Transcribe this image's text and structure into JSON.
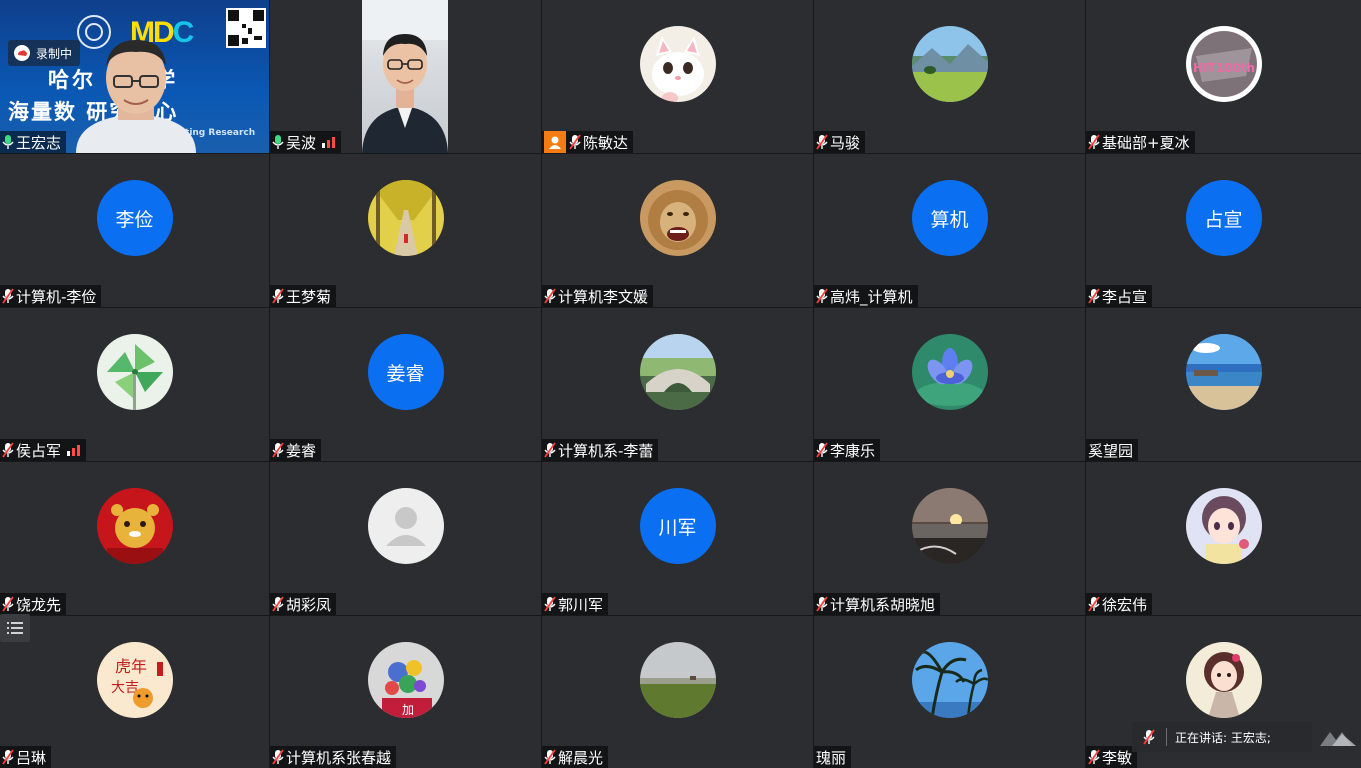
{
  "recording_label": "录制中",
  "host_banner": {
    "line1": "哈尔 业大学",
    "line2": "海量数 研究中心",
    "caption": "Computing Research Center",
    "logo_text": "MD",
    "logo_accent": "C"
  },
  "speaking_label": "正在讲话: 王宏志;",
  "colors": {
    "tile_bg": "#2b2d30",
    "text_avatar_bg": "#0b6ff2",
    "host_badge": "#f57c12",
    "mic_on": "#3ddc84",
    "signal": "#ff4b4b"
  },
  "participants": [
    {
      "name": "王宏志",
      "kind": "video-host",
      "mic": "on"
    },
    {
      "name": "吴波",
      "kind": "video-guest",
      "mic": "on",
      "signal": true
    },
    {
      "name": "陈敏达",
      "kind": "avatar",
      "image": "cat",
      "mic": "off",
      "host": true
    },
    {
      "name": "马骏",
      "kind": "avatar",
      "image": "meadow",
      "mic": "off"
    },
    {
      "name": "基础部+夏冰",
      "kind": "avatar",
      "image": "hit-logo",
      "mic": "off"
    },
    {
      "name": "计算机-李俭",
      "kind": "text",
      "initials": "李俭",
      "mic": "off"
    },
    {
      "name": "王梦菊",
      "kind": "avatar",
      "image": "ginkgo-path",
      "mic": "off"
    },
    {
      "name": "计算机李文媛",
      "kind": "avatar",
      "image": "lion",
      "mic": "off"
    },
    {
      "name": "高炜_计算机",
      "kind": "text",
      "initials": "算机",
      "mic": "off"
    },
    {
      "name": "李占宣",
      "kind": "text",
      "initials": "占宣",
      "mic": "off"
    },
    {
      "name": "侯占军",
      "kind": "avatar",
      "image": "pinwheel",
      "mic": "off",
      "signal": true
    },
    {
      "name": "姜睿",
      "kind": "text",
      "initials": "姜睿",
      "mic": "off"
    },
    {
      "name": "计算机系-李蕾",
      "kind": "avatar",
      "image": "stone-bridge",
      "mic": "off"
    },
    {
      "name": "李康乐",
      "kind": "avatar",
      "image": "lotus",
      "mic": "off"
    },
    {
      "name": "奚望园",
      "kind": "avatar",
      "image": "beach",
      "mic": "none"
    },
    {
      "name": "饶龙先",
      "kind": "avatar",
      "image": "tiger-toy",
      "mic": "off"
    },
    {
      "name": "胡彩凤",
      "kind": "avatar",
      "image": "default-user",
      "mic": "off"
    },
    {
      "name": "郭川军",
      "kind": "text",
      "initials": "川军",
      "mic": "off"
    },
    {
      "name": "计算机系胡晓旭",
      "kind": "avatar",
      "image": "sunset",
      "mic": "off"
    },
    {
      "name": "徐宏伟",
      "kind": "avatar",
      "image": "anime-girl",
      "mic": "off"
    },
    {
      "name": "吕琳",
      "kind": "avatar",
      "image": "tiger-year",
      "mic": "off"
    },
    {
      "name": "计算机系张春越",
      "kind": "avatar",
      "image": "flowers",
      "mic": "off"
    },
    {
      "name": "解晨光",
      "kind": "avatar",
      "image": "field",
      "mic": "off"
    },
    {
      "name": "瑰丽",
      "kind": "avatar",
      "image": "palm-trees",
      "mic": "none"
    },
    {
      "name": "李敏",
      "kind": "avatar",
      "image": "cartoon-girl",
      "mic": "off"
    }
  ]
}
